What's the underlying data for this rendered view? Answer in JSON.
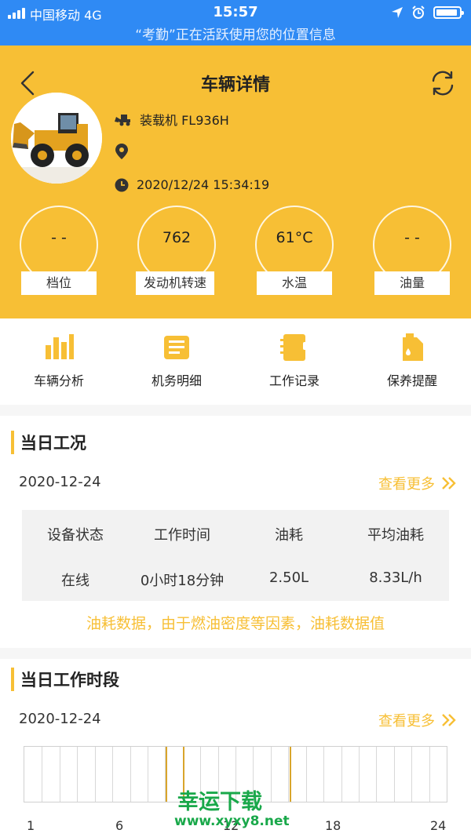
{
  "status_bar": {
    "carrier": "中国移动  4G",
    "time": "15:57",
    "location_banner": "“考勤”正在活跃使用您的位置信息"
  },
  "header": {
    "title": "车辆详情",
    "vehicle_name": "装载机 FL936H",
    "location": "",
    "timestamp": "2020/12/24 15:34:19"
  },
  "gauges": [
    {
      "label": "档位",
      "value": "- -"
    },
    {
      "label": "发动机转速",
      "value": "762"
    },
    {
      "label": "水温",
      "value": "61°C"
    },
    {
      "label": "油量",
      "value": "- -"
    }
  ],
  "quick_menu": [
    {
      "label": "车辆分析",
      "icon": "bar-chart-icon"
    },
    {
      "label": "机务明细",
      "icon": "document-icon"
    },
    {
      "label": "工作记录",
      "icon": "notebook-icon"
    },
    {
      "label": "保养提醒",
      "icon": "oil-can-icon"
    }
  ],
  "today_status": {
    "title": "当日工况",
    "date": "2020-12-24",
    "more_label": "查看更多",
    "headers": [
      "设备状态",
      "工作时间",
      "油耗",
      "平均油耗"
    ],
    "values": [
      "在线",
      "0小时18分钟",
      "2.50L",
      "8.33L/h"
    ],
    "notice": "油耗数据，由于燃油密度等因素，油耗数据值"
  },
  "work_period": {
    "title": "当日工作时段",
    "date": "2020-12-24",
    "more_label": "查看更多",
    "axis_labels": [
      "1",
      "6",
      "12",
      "18",
      "24"
    ]
  },
  "watermark": {
    "name": "幸运下载",
    "url": "www.xyxy8.net"
  },
  "colors": {
    "accent": "#f7bf35",
    "status_bar": "#2f8af4"
  }
}
